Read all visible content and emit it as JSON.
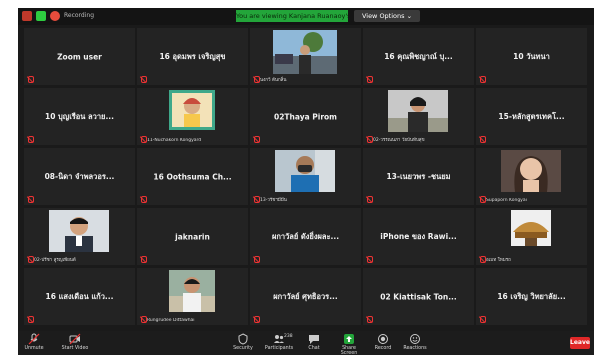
{
  "topbar": {
    "label": "Recording",
    "share_banner": "You are viewing Kanjana Ruanaoy's screen",
    "view_options": "View Options ⌄"
  },
  "tiles": [
    {
      "name": "Zoom user",
      "label": ""
    },
    {
      "name": "16 อุดมพร เจริญสุข",
      "label": ""
    },
    {
      "name": "",
      "label": "นงกวี ต้นกลิ่น"
    },
    {
      "name": "16 คุณพิชญาณ์ บุ...",
      "label": ""
    },
    {
      "name": "10 วันทนา",
      "label": ""
    },
    {
      "name": "10 บุญเรือน ลวาย...",
      "label": ""
    },
    {
      "name": "",
      "label": "11-Nuchakorn Kongyard"
    },
    {
      "name": "02Thaya Pirom",
      "label": ""
    },
    {
      "name": "",
      "label": "02-วรรณนภา วัยบันทับสุข"
    },
    {
      "name": "15-หลักสูตรเทคโ...",
      "label": ""
    },
    {
      "name": "08-นิดา จำพลวอร...",
      "label": ""
    },
    {
      "name": "16 Oothsuma Ch...",
      "label": ""
    },
    {
      "name": "",
      "label": "13-วรัชฯมีมีน"
    },
    {
      "name": "13-เนยวพร -ชนยม",
      "label": ""
    },
    {
      "name": "",
      "label": "Supaporn Kongyai"
    },
    {
      "name": "",
      "label": "02-ปรีชา สูรญเพียนต์"
    },
    {
      "name": "jaknarin",
      "label": ""
    },
    {
      "name": "ผกาวัลย์ ดังยิ่งผละ...",
      "label": ""
    },
    {
      "name": "iPhone ของ Rawi...",
      "label": ""
    },
    {
      "name": "",
      "label": "อเมท ใหมรถ"
    },
    {
      "name": "16 แสงเดือน แก้ว...",
      "label": ""
    },
    {
      "name": "",
      "label": "Rungrudee Dittawhai"
    },
    {
      "name": "ผกาวัลย์ ศุทธิอวร...",
      "label": ""
    },
    {
      "name": "02 Kiattisak Ton...",
      "label": ""
    },
    {
      "name": "16 เจริญ วิทยาลัย...",
      "label": ""
    }
  ],
  "toolbar": {
    "unmute": "Unmute",
    "start_video": "Start Video",
    "security": "Security",
    "participants": "Participants",
    "participants_count": "238",
    "chat": "Chat",
    "share_screen": "Share Screen",
    "record": "Record",
    "reactions": "Reactions",
    "end": "Leave"
  },
  "colors": {
    "background": "#1a1a1a",
    "tile": "#232323",
    "share_banner": "#23a53a",
    "mute_red": "#e33333",
    "end_red": "#e02828"
  }
}
